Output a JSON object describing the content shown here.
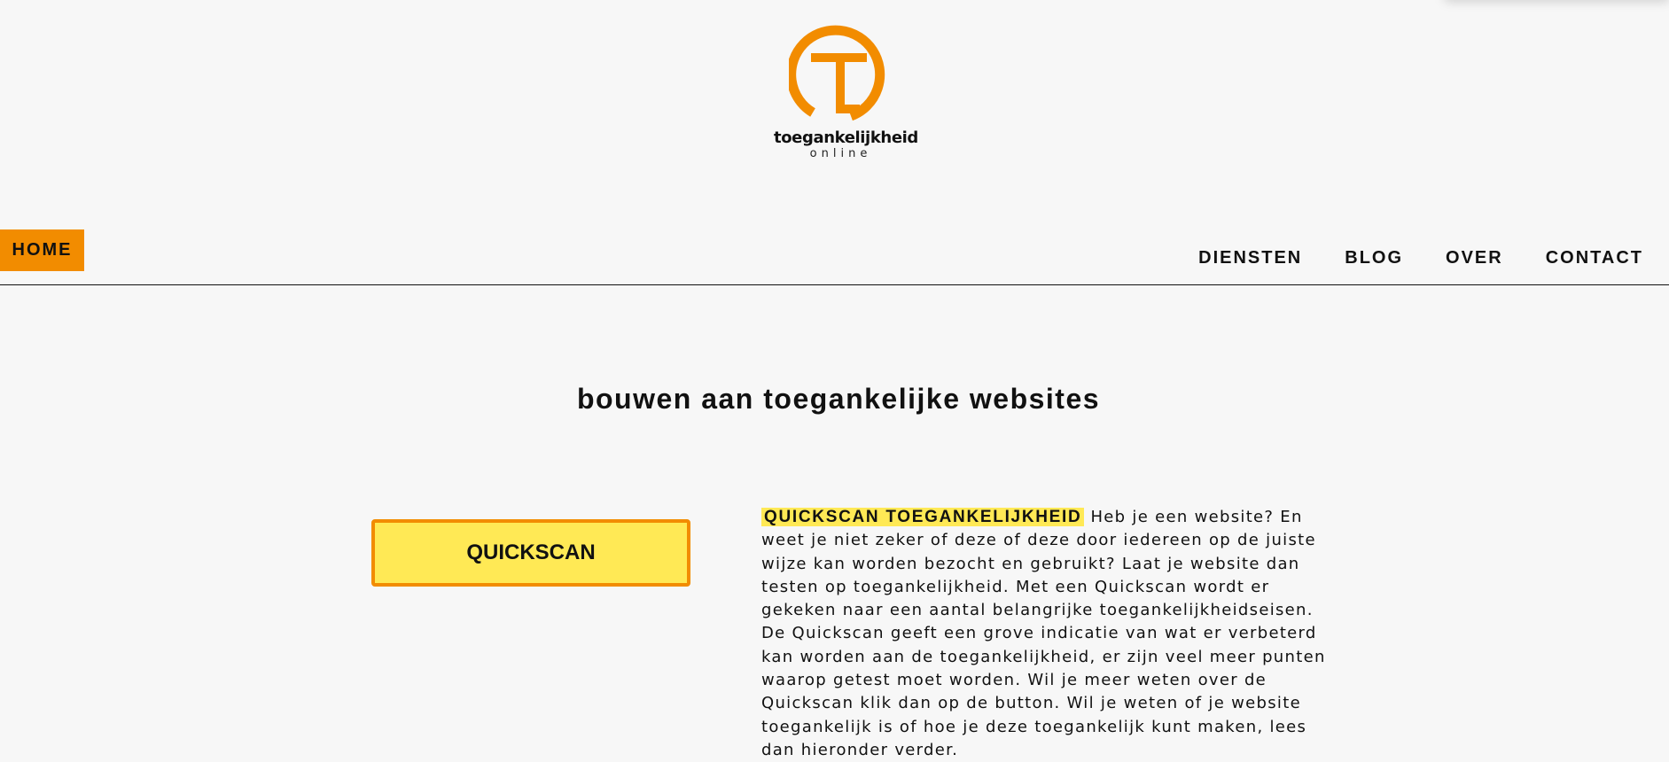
{
  "logo": {
    "title": "toegankelijkheid",
    "subtitle": "online",
    "brand_color": "#f28c00"
  },
  "nav": {
    "home": "HOME",
    "items": [
      "DIENSTEN",
      "BLOG",
      "OVER",
      "CONTACT"
    ],
    "active_color": "#f28c00"
  },
  "main": {
    "headline": "bouwen aan toegankelijke websites",
    "quickscan_button": "QUICKSCAN",
    "highlight": "QUICKSCAN TOEGANKELIJKHEID",
    "highlight_color": "#ffe955",
    "paragraph": "Heb je een website? En weet je niet zeker of deze of deze door iedereen op de juiste wijze kan worden bezocht en gebruikt? Laat je website dan testen op toegankelijkheid. Met een Quickscan wordt er gekeken naar een aantal belangrijke toegankelijkheidseisen. De Quickscan geeft een grove indicatie van wat er verbeterd kan worden aan de toegankelijkheid, er zijn veel meer punten waarop getest moet worden. Wil je meer weten over de Quickscan klik dan op de button. Wil je weten of je website toegankelijk is of hoe je deze toegankelijk kunt maken, lees dan hieronder verder."
  }
}
